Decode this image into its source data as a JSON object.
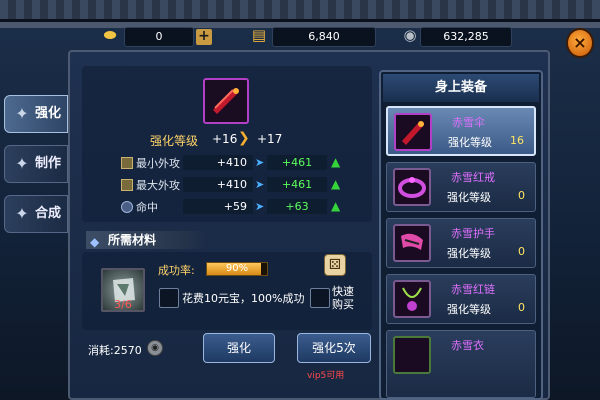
{
  "currency": {
    "gold_ingot": "0",
    "vouchers": "6,840",
    "coins": "632,285",
    "plus_label": "+",
    "close_label": "×"
  },
  "tabs": [
    {
      "label": "强化",
      "icon": "hammer-icon",
      "active": true
    },
    {
      "label": "制作",
      "icon": "anvil-icon",
      "active": false
    },
    {
      "label": "合成",
      "icon": "merge-icon",
      "active": false
    }
  ],
  "upgrade": {
    "level_label": "强化等级",
    "level_from": "+16",
    "level_to": "+17",
    "stats": [
      {
        "name": "最小外攻",
        "old": "+410",
        "new": "+461"
      },
      {
        "name": "最大外攻",
        "old": "+410",
        "new": "+461"
      },
      {
        "name": "命中",
        "old": "+59",
        "new": "+63"
      }
    ]
  },
  "materials": {
    "header": "所需材料",
    "gem_count": "3/6",
    "rate_label": "成功率:",
    "rate_value": "90%",
    "rate_fraction": 0.9,
    "pay_text": "花费10元宝，100%成功",
    "quick_buy": "快速购买"
  },
  "actions": {
    "cost_label": "消耗:2570",
    "enhance": "强化",
    "enhance5": "强化5次",
    "vip_note": "vip5可用"
  },
  "equipment": {
    "title": "身上装备",
    "level_label": "强化等级",
    "items": [
      {
        "name": "赤雪伞",
        "level": "16",
        "icon": "umbrella-icon"
      },
      {
        "name": "赤雪红戒",
        "level": "0",
        "icon": "ring-icon"
      },
      {
        "name": "赤雪护手",
        "level": "0",
        "icon": "bracer-icon"
      },
      {
        "name": "赤雪红链",
        "level": "0",
        "icon": "necklace-icon"
      },
      {
        "name": "赤雪衣",
        "level": "",
        "icon": "armor-icon"
      }
    ]
  },
  "colors": {
    "accent_gold": "#ffd36a",
    "item_purple": "#e070ff",
    "stat_green": "#5cff5c",
    "vip_red": "#ff4a4a"
  }
}
